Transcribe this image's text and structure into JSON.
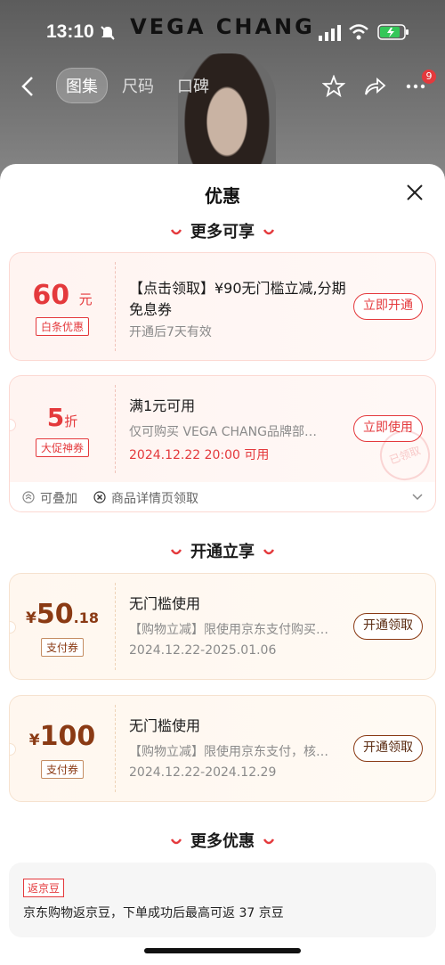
{
  "status_bar": {
    "time": "13:10"
  },
  "brand": "VEGA CHANG",
  "nav": {
    "tabs": [
      {
        "label": "图集"
      },
      {
        "label": "尺码"
      },
      {
        "label": "口碑"
      }
    ],
    "more_badge": "9"
  },
  "sheet": {
    "title": "优惠",
    "sections": {
      "more_available": "更多可享",
      "open_enjoy": "开通立享",
      "more_offers": "更多优惠"
    },
    "cards": [
      {
        "amount": "60",
        "unit": "元",
        "tag": "白条优惠",
        "title": "【点击领取】¥90无门槛立减,分期免息券",
        "sub": "开通后7天有效",
        "button": "立即开通"
      },
      {
        "amount": "5",
        "unit": "折",
        "tag": "大促神券",
        "title": "满1元可用",
        "sub": "仅可购买 VEGA CHANG品牌部…",
        "date": "2024.12.22 20:00 可用",
        "button": "立即使用",
        "stamp": "已领取",
        "foot_left": "可叠加",
        "foot_right": "商品详情页领取"
      },
      {
        "currency": "¥",
        "amount": "50",
        "decimal": ".18",
        "tag": "支付券",
        "title": "无门槛使用",
        "sub": "【购物立减】限使用京东支付购买…",
        "date": "2024.12.22-2025.01.06",
        "button": "开通领取"
      },
      {
        "currency": "¥",
        "amount": "100",
        "tag": "支付券",
        "title": "无门槛使用",
        "sub": "【购物立减】限使用京东支付，核…",
        "date": "2024.12.22-2024.12.29",
        "button": "开通领取"
      }
    ],
    "bean": {
      "label": "返京豆",
      "text": "京东购物返京豆，下单成功后最高可返 37 京豆"
    }
  },
  "colors": {
    "accent_red": "#e4393c",
    "brown": "#8a3a14",
    "gold_border": "#f6e2cf"
  }
}
